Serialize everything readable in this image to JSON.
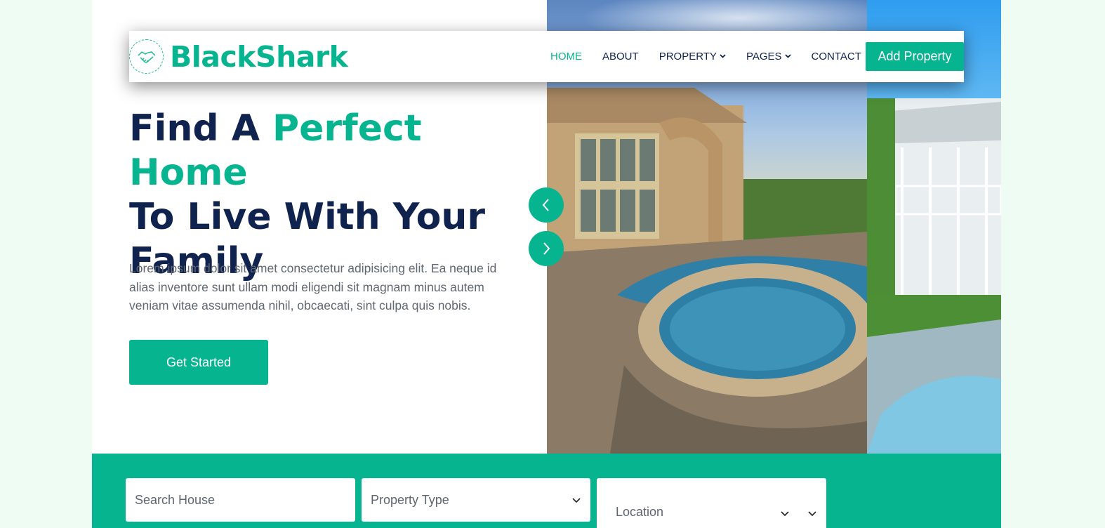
{
  "brand": {
    "name": "BlackShark",
    "icon": "handshake-icon",
    "accent_color": "#06b58f"
  },
  "nav": {
    "items": [
      {
        "label": "HOME",
        "active": true
      },
      {
        "label": "ABOUT",
        "active": false
      },
      {
        "label": "PROPERTY",
        "active": false,
        "dropdown": true
      },
      {
        "label": "PAGES",
        "active": false,
        "dropdown": true
      },
      {
        "label": "CONTACT",
        "active": false
      }
    ],
    "cta": "Add Property"
  },
  "hero": {
    "title_part1": "Find A ",
    "title_accent": "Perfect Home",
    "title_part2": "To Live With Your Family",
    "description": "Lorem ipsum dolor sit amet consectetur adipisicing elit. Ea neque id alias inventore sunt ullam modi eligendi sit magnam minus autem veniam vitae assumenda nihil, obcaecati, sint culpa quis nobis.",
    "button": "Get Started",
    "prev_icon": "chevron-left-icon",
    "next_icon": "chevron-right-icon"
  },
  "search": {
    "house_placeholder": "Search House",
    "property_type": "Property Type",
    "location": "Location"
  }
}
